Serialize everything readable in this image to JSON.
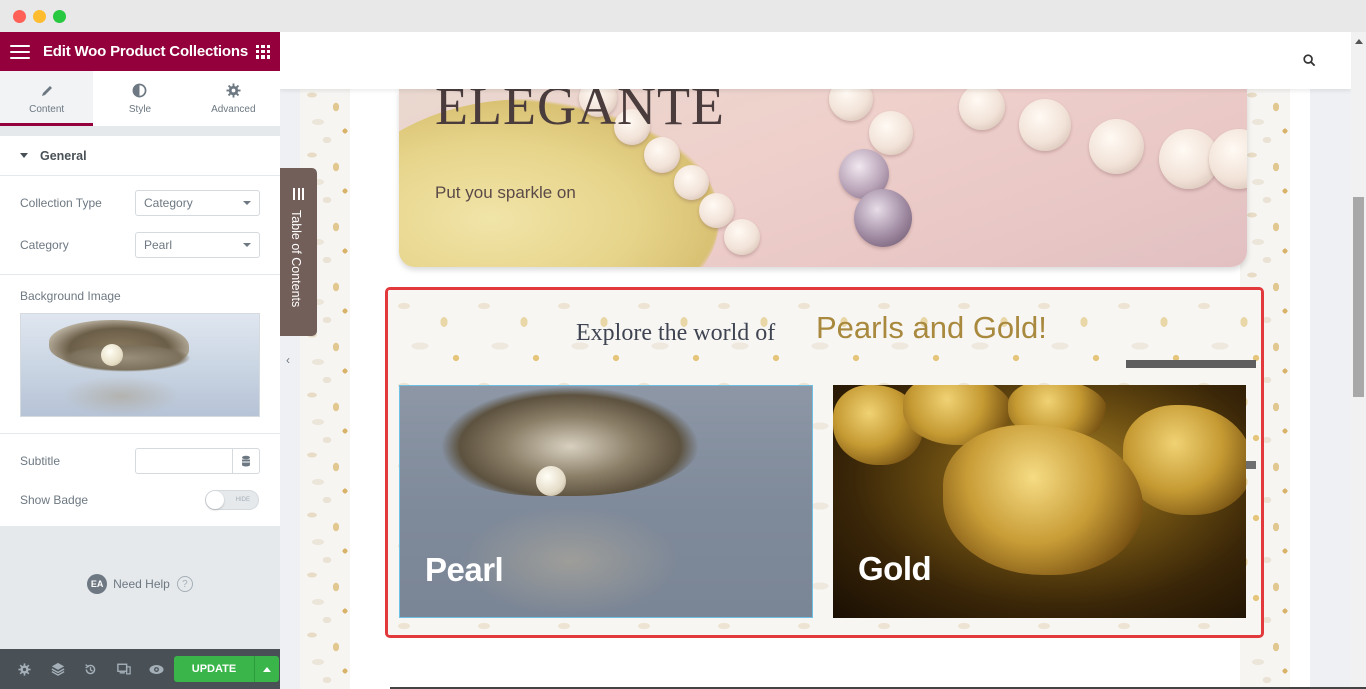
{
  "window": {
    "controls": [
      "close",
      "minimize",
      "maximize"
    ]
  },
  "panel": {
    "title": "Edit Woo Product Collections",
    "tabs": [
      {
        "label": "Content",
        "icon": "pencil-icon",
        "active": true
      },
      {
        "label": "Style",
        "icon": "half-circle-icon",
        "active": false
      },
      {
        "label": "Advanced",
        "icon": "gear-icon",
        "active": false
      }
    ],
    "section": {
      "title": "General",
      "collection_type_label": "Collection Type",
      "collection_type_value": "Category",
      "category_label": "Category",
      "category_value": "Pearl",
      "background_image_label": "Background Image",
      "subtitle_label": "Subtitle",
      "subtitle_value": "",
      "show_badge_label": "Show Badge",
      "show_badge_state": "HIDE"
    },
    "help": {
      "badge": "EA",
      "label": "Need Help",
      "icon": "?"
    },
    "footer": {
      "icons": [
        "gear-icon",
        "layers-icon",
        "history-icon",
        "responsive-icon",
        "eye-icon"
      ],
      "update_label": "UPDATE"
    }
  },
  "toc": {
    "label": "Table of Contents"
  },
  "preview": {
    "hero": {
      "title": "ELEGANTE",
      "subtitle": "Put you sparkle on"
    },
    "collection": {
      "heading_prefix": "Explore the world of",
      "heading_highlight": "Pearls and Gold!",
      "cards": [
        {
          "label": "Pearl"
        },
        {
          "label": "Gold"
        }
      ]
    }
  },
  "colors": {
    "brand": "#93003c",
    "update": "#39b54a",
    "highlight_border": "#e2393c",
    "heading_gold": "#a8893e"
  }
}
